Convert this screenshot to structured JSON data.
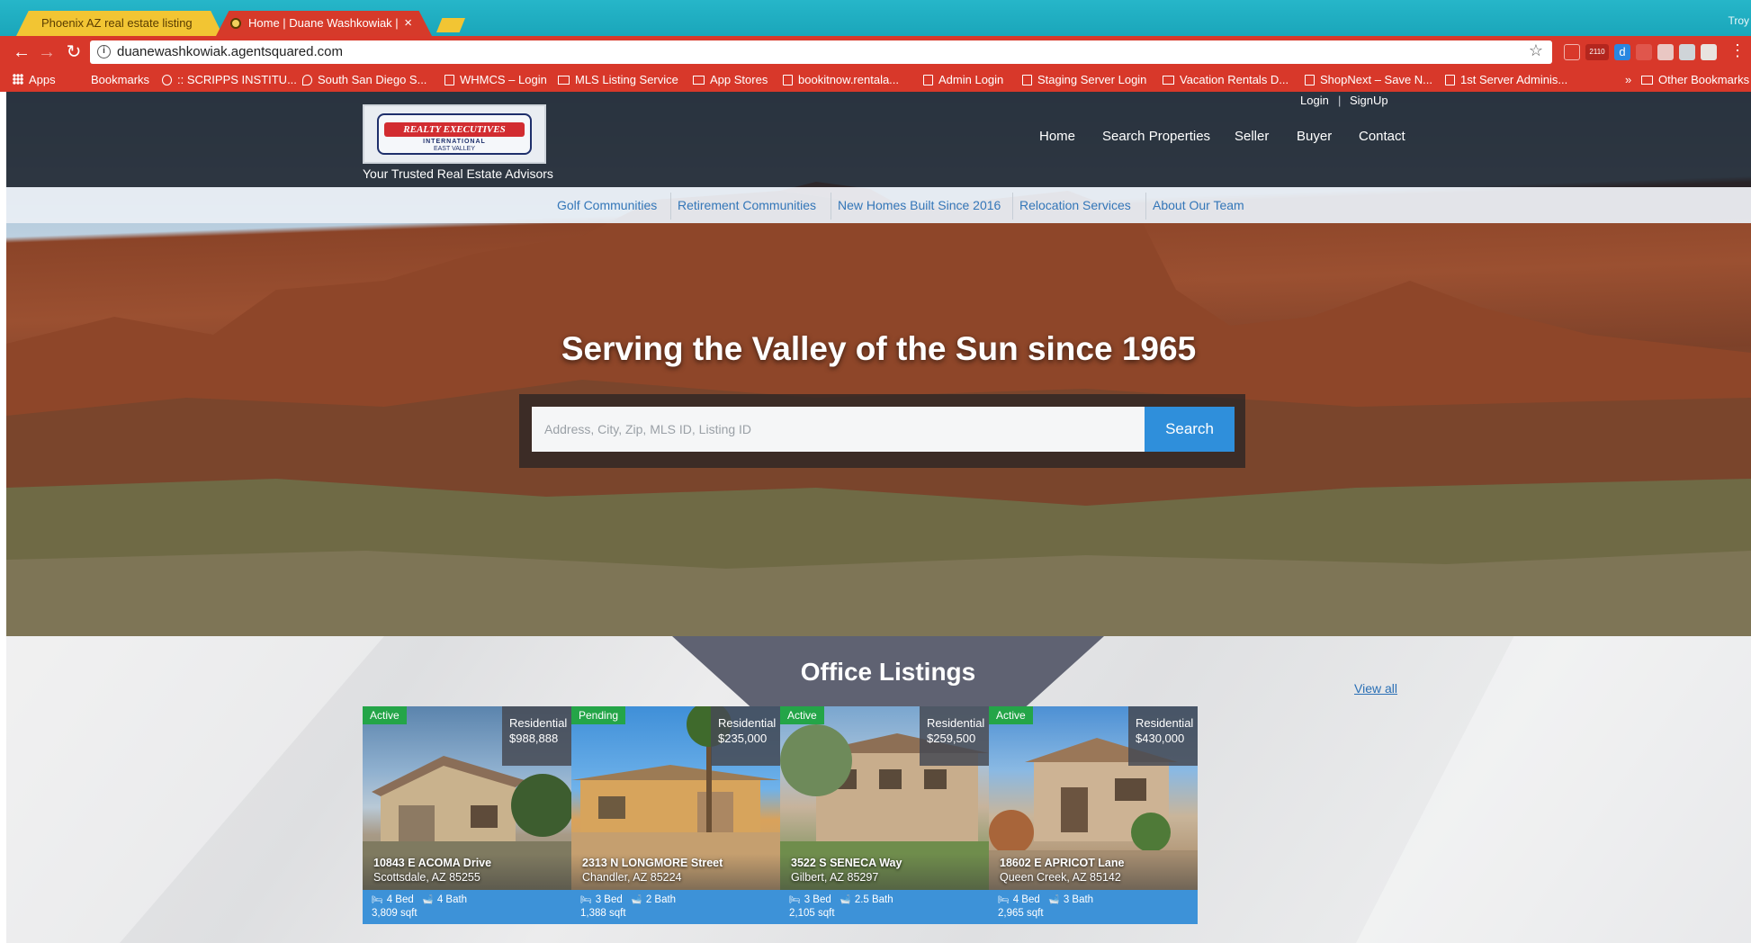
{
  "browser": {
    "tabs": [
      {
        "title": "Phoenix AZ real estate listing",
        "active": false
      },
      {
        "title": "Home | Duane Washkowiak | ",
        "active": true
      }
    ],
    "window_user": "Troy",
    "url": "duanewashkowiak.agentsquared.com",
    "extension_badge": "2110",
    "bookmarks": [
      {
        "label": "Apps",
        "icon": "apps-icon"
      },
      {
        "label": "Bookmarks",
        "icon": "folder-icon"
      },
      {
        "label": ":: SCRIPPS INSTITU...",
        "icon": "globe-icon"
      },
      {
        "label": "South San Diego S...",
        "icon": "drop-icon"
      },
      {
        "label": "WHMCS – Login",
        "icon": "page-icon"
      },
      {
        "label": "MLS Listing Service",
        "icon": "folder-icon"
      },
      {
        "label": "App Stores",
        "icon": "folder-icon"
      },
      {
        "label": "bookitnow.rentala...",
        "icon": "page-icon"
      },
      {
        "label": "Admin Login",
        "icon": "page-icon"
      },
      {
        "label": "Staging Server Login",
        "icon": "page-icon"
      },
      {
        "label": "Vacation Rentals D...",
        "icon": "folder-icon"
      },
      {
        "label": "ShopNext – Save N...",
        "icon": "page-icon"
      },
      {
        "label": "1st Server Adminis...",
        "icon": "page-icon"
      }
    ],
    "overflow": "»",
    "other_bookmarks": "Other Bookmarks"
  },
  "site": {
    "logo": {
      "line1": "REALTY EXECUTIVES",
      "line2": "INTERNATIONAL",
      "line3": "EAST VALLEY"
    },
    "tagline": "Your Trusted Real Estate Advisors",
    "auth": {
      "login": "Login",
      "separator": "|",
      "signup": "SignUp"
    },
    "nav": [
      "Home",
      "Search Properties",
      "Seller",
      "Buyer",
      "Contact"
    ],
    "subnav": [
      "Golf Communities",
      "Retirement Communities",
      "New Homes Built Since 2016",
      "Relocation Services",
      "About Our Team"
    ],
    "hero_title": "Serving the Valley of the Sun since 1965",
    "search": {
      "placeholder": "Address, City, Zip, MLS ID, Listing ID",
      "button": "Search"
    },
    "listings": {
      "title": "Office Listings",
      "view_all": "View all",
      "cards": [
        {
          "status": "Active",
          "type": "Residential",
          "price": "$988,888",
          "street": "10843 E ACOMA Drive",
          "city": "Scottsdale, AZ 85255",
          "beds": "4 Bed",
          "baths": "4 Bath",
          "sqft": "3,809 sqft"
        },
        {
          "status": "Pending",
          "type": "Residential",
          "price": "$235,000",
          "street": "2313 N LONGMORE Street",
          "city": "Chandler, AZ 85224",
          "beds": "3 Bed",
          "baths": "2 Bath",
          "sqft": "1,388 sqft"
        },
        {
          "status": "Active",
          "type": "Residential",
          "price": "$259,500",
          "street": "3522 S SENECA Way",
          "city": "Gilbert, AZ 85297",
          "beds": "3 Bed",
          "baths": "2.5 Bath",
          "sqft": "2,105 sqft"
        },
        {
          "status": "Active",
          "type": "Residential",
          "price": "$430,000",
          "street": "18602 E APRICOT Lane",
          "city": "Queen Creek, AZ 85142",
          "beds": "4 Bed",
          "baths": "3 Bath",
          "sqft": "2,965 sqft"
        }
      ]
    }
  }
}
